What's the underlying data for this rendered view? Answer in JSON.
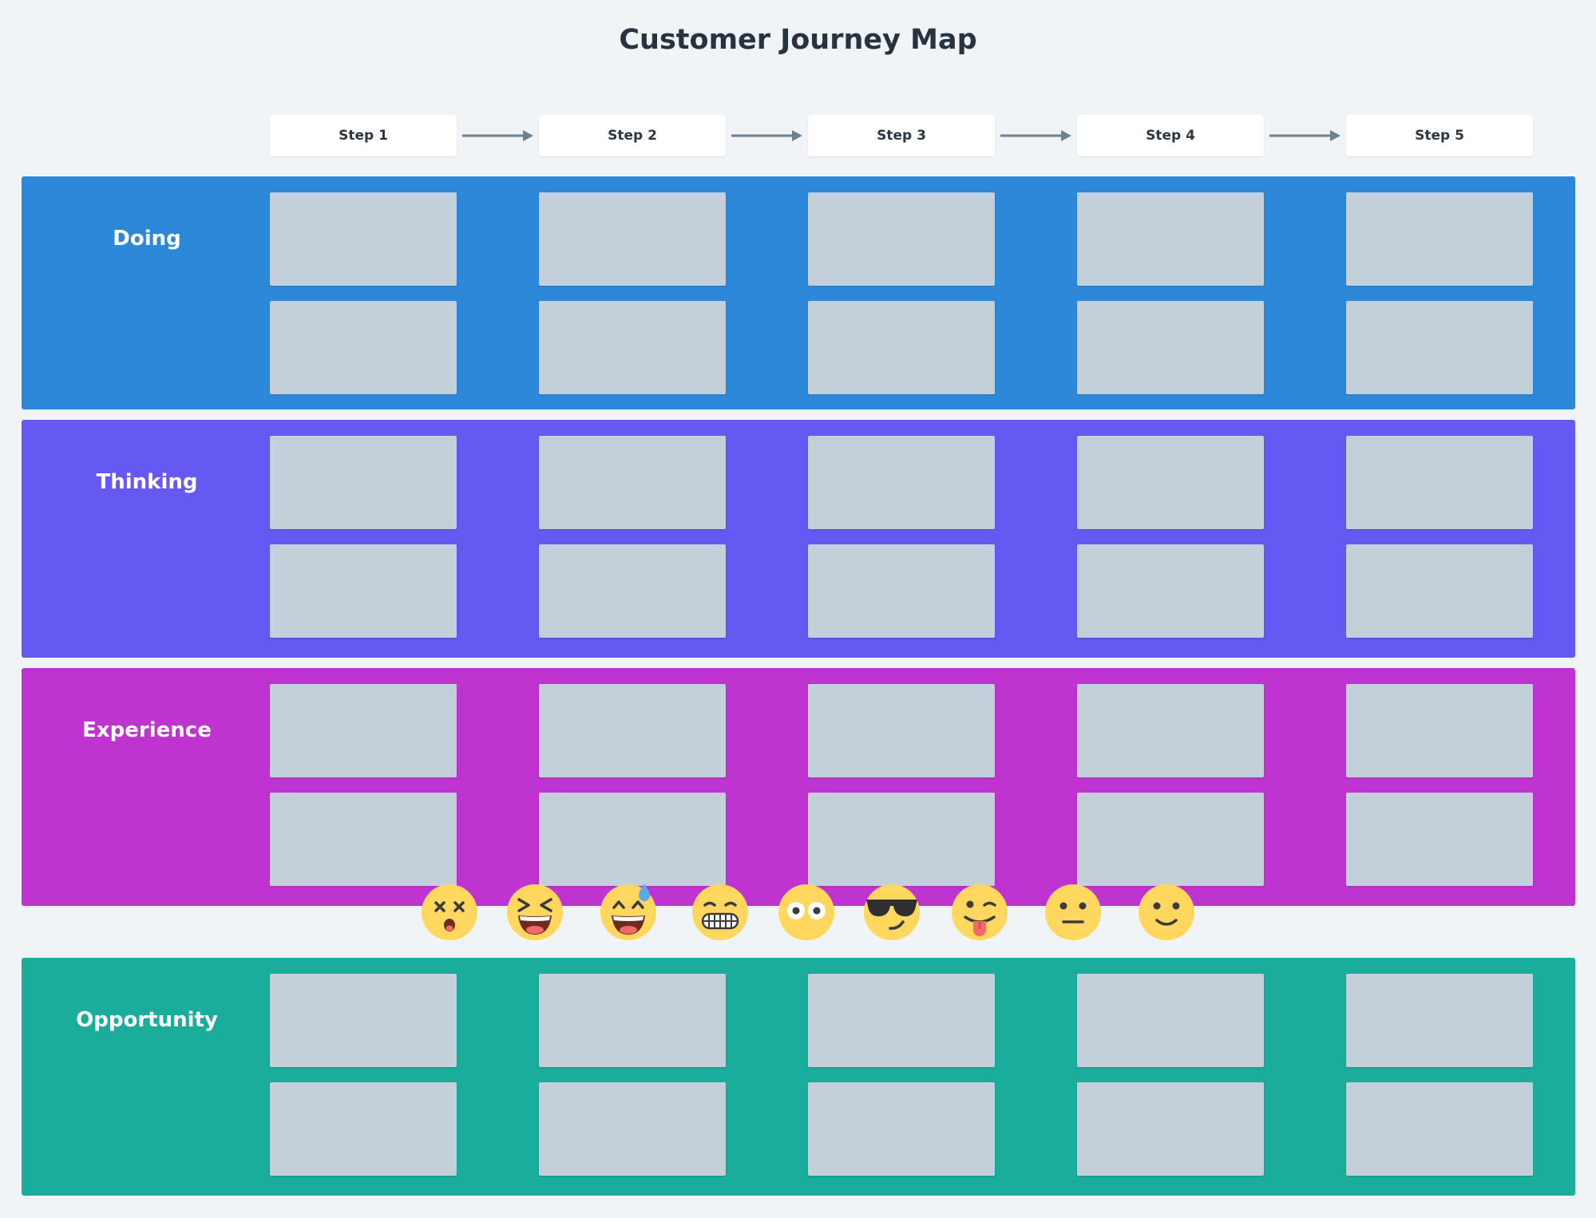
{
  "title": "Customer Journey Map",
  "steps": [
    "Step 1",
    "Step 2",
    "Step 3",
    "Step 4",
    "Step 5"
  ],
  "lanes": [
    {
      "label": "Doing",
      "color": "#2d88d9"
    },
    {
      "label": "Thinking",
      "color": "#6659f3"
    },
    {
      "label": "Experience",
      "color": "#bf34d1"
    },
    {
      "label": "Opportunity",
      "color": "#1bad9c"
    }
  ],
  "note_color": "#c4d0d9",
  "emojis": [
    "dizzy-face-icon",
    "laughing-squinting-face-icon",
    "grinning-sweat-face-icon",
    "grimacing-face-icon",
    "flushed-face-icon",
    "sunglasses-face-icon",
    "winking-tongue-face-icon",
    "neutral-face-icon",
    "slightly-smiling-face-icon"
  ]
}
